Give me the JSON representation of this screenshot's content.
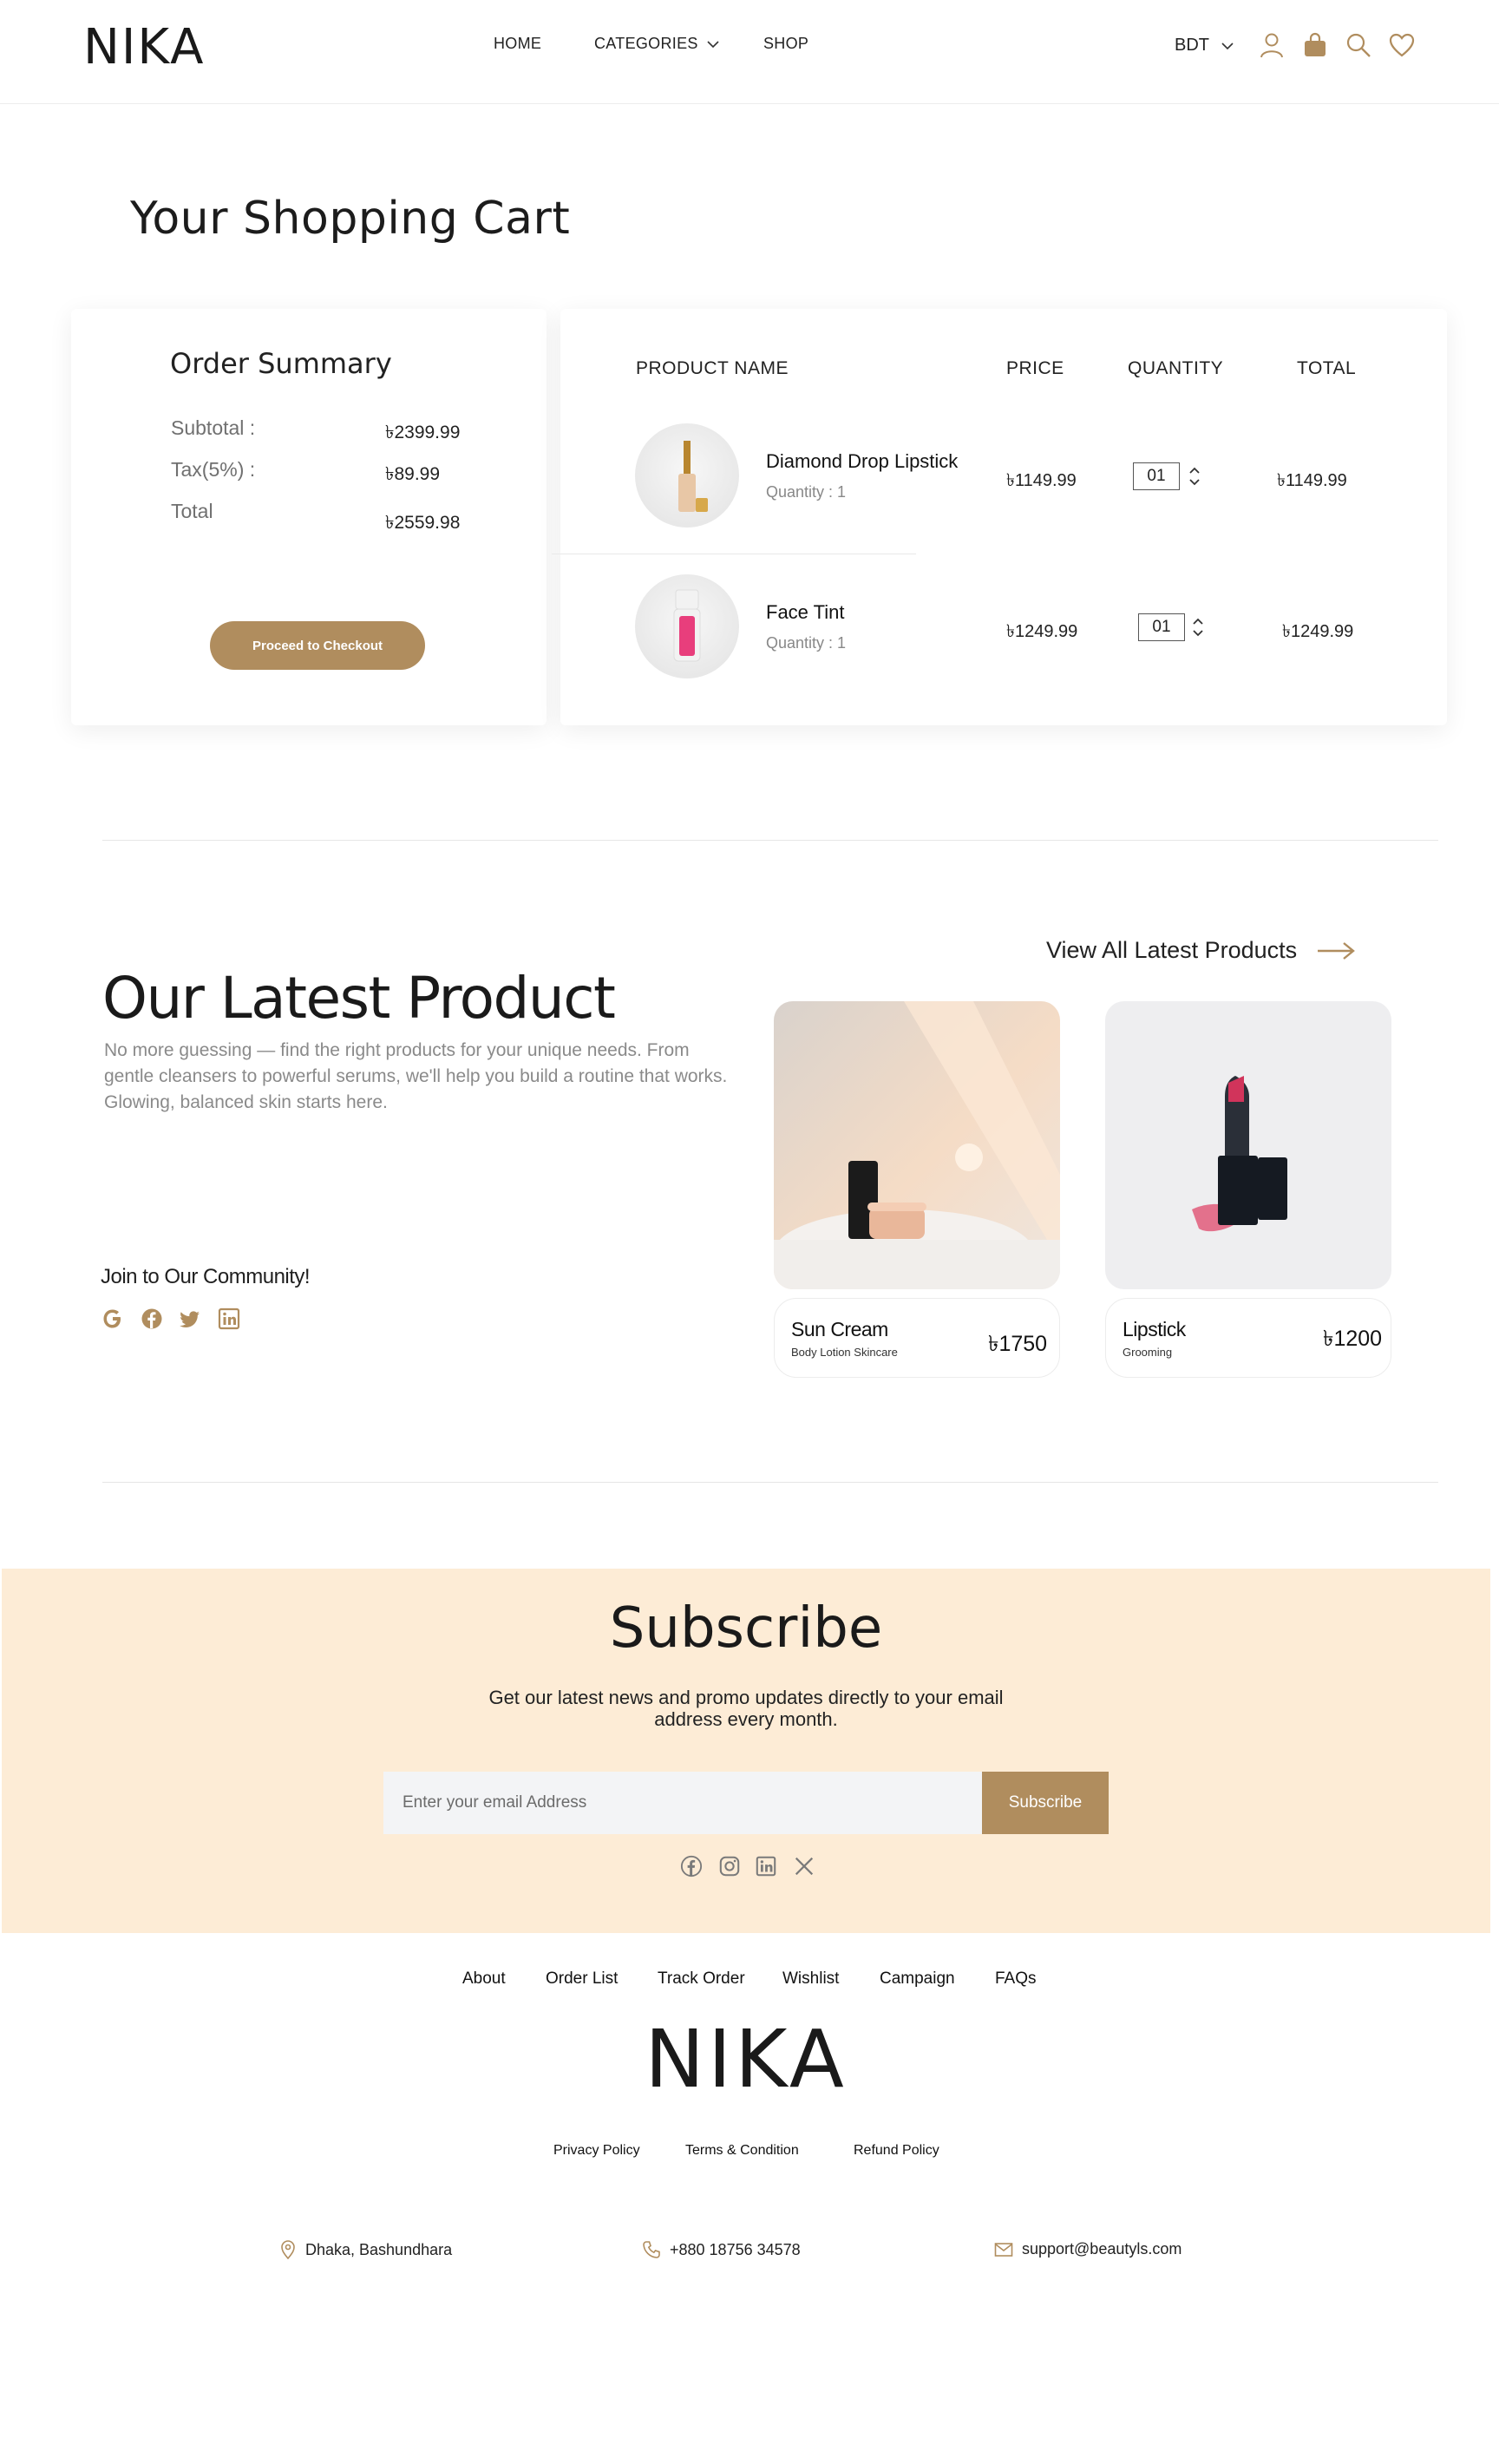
{
  "header": {
    "logo": "NIKA",
    "nav": [
      {
        "label": "HOME"
      },
      {
        "label": "CATEGORIES"
      },
      {
        "label": "SHOP"
      }
    ],
    "currency": "BDT",
    "icons": [
      "user-icon",
      "bag-icon",
      "search-icon",
      "heart-icon"
    ]
  },
  "page_title": "Your Shopping Cart",
  "summary": {
    "title": "Order Summary",
    "subtotal_label": "Subtotal  :",
    "subtotal_value": "৳2399.99",
    "tax_label": "Tax(5%) :",
    "tax_value": "৳89.99",
    "total_label": "Total",
    "total_value": "৳2559.98",
    "checkout_label": "Proceed to Checkout"
  },
  "cart": {
    "headers": {
      "product": "PRODUCT NAME",
      "price": "PRICE",
      "quantity": "QUANTITY",
      "total": "TOTAL"
    },
    "items": [
      {
        "name": "Diamond Drop Lipstick",
        "qty_label": "Quantity : 1",
        "price": "৳1149.99",
        "quantity": "01",
        "total": "৳1149.99"
      },
      {
        "name": "Face Tint",
        "qty_label": "Quantity : 1",
        "price": "৳1249.99",
        "quantity": "01",
        "total": "৳1249.99"
      }
    ]
  },
  "latest": {
    "title": "Our Latest Product",
    "description": "No more guessing — find the right products for your unique needs. From gentle cleansers to powerful serums, we'll help you build a routine that works. Glowing, balanced skin starts here.",
    "view_all": "View All Latest Products",
    "community": "Join to Our Community!",
    "community_icons": [
      "google-icon",
      "facebook-icon",
      "twitter-icon",
      "linkedin-icon"
    ],
    "products": [
      {
        "name": "Sun Cream",
        "category": "Body Lotion Skincare",
        "price": "৳1750"
      },
      {
        "name": "Lipstick",
        "category": "Grooming",
        "price": "৳1200"
      }
    ]
  },
  "subscribe": {
    "title": "Subscribe",
    "description": "Get our latest news and promo updates directly to your email address every month.",
    "placeholder": "Enter your email Address",
    "button": "Subscribe",
    "icons": [
      "facebook-icon",
      "instagram-icon",
      "linkedin-icon",
      "x-icon"
    ]
  },
  "footer": {
    "links": [
      "About",
      "Order List",
      "Track Order",
      "Wishlist",
      "Campaign",
      "FAQs"
    ],
    "logo": "NIKA",
    "policies": [
      "Privacy Policy",
      "Terms & Condition",
      "Refund Policy"
    ],
    "address": "Dhaka, Bashundhara",
    "phone": "+880 18756 34578",
    "email": "support@beautyls.com"
  },
  "colors": {
    "accent": "#b08d5e",
    "subscribe_bg": "#fdecd6",
    "text_muted": "#8a8a8a"
  }
}
